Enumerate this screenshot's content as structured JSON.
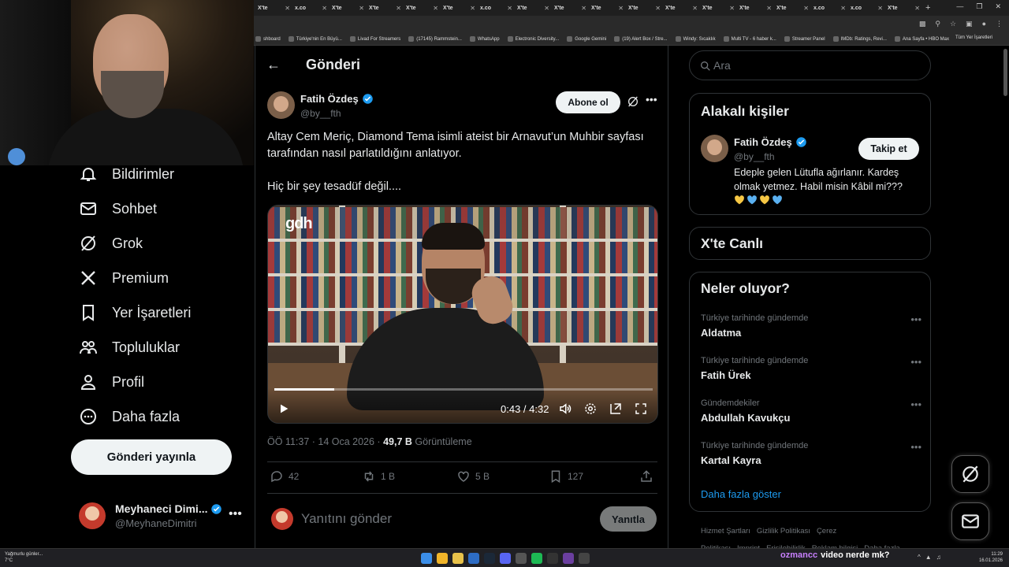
{
  "browser": {
    "tabs": [
      {
        "label": "X'te"
      },
      {
        "label": "x.co"
      },
      {
        "label": "X'te"
      },
      {
        "label": "X'te"
      },
      {
        "label": "X'te"
      },
      {
        "label": "X'te"
      },
      {
        "label": "x.co"
      },
      {
        "label": "X'te"
      },
      {
        "label": "X'te"
      },
      {
        "label": "X'te"
      },
      {
        "label": "X'te"
      },
      {
        "label": "X'te"
      },
      {
        "label": "X'te"
      },
      {
        "label": "X'te"
      },
      {
        "label": "X'te"
      },
      {
        "label": "x.co"
      },
      {
        "label": "x.co"
      },
      {
        "label": "X'te"
      }
    ],
    "bookmarks": [
      {
        "label": "shboard"
      },
      {
        "label": "Türkiye'nin En Büyü..."
      },
      {
        "label": "Livad For Streamers"
      },
      {
        "label": "(17145) Rammstein..."
      },
      {
        "label": "WhatsApp"
      },
      {
        "label": "Electronic Diversity..."
      },
      {
        "label": "Google Gemini"
      },
      {
        "label": "(19) Alert Box / Stre..."
      },
      {
        "label": "Windy: Sıcaklık"
      },
      {
        "label": "Multi TV - 6 haber k..."
      },
      {
        "label": "Streamer Panel"
      },
      {
        "label": "IMDb: Ratings, Revi..."
      },
      {
        "label": "Ana Sayfa • HBO Max"
      }
    ],
    "bookmarks_all": "Tüm Yer İşaretleri"
  },
  "nav": {
    "items": [
      {
        "label": "Bildirimler",
        "icon": "bell-icon"
      },
      {
        "label": "Sohbet",
        "icon": "mail-icon"
      },
      {
        "label": "Grok",
        "icon": "grok-icon"
      },
      {
        "label": "Premium",
        "icon": "x-logo-icon"
      },
      {
        "label": "Yer İşaretleri",
        "icon": "bookmark-icon"
      },
      {
        "label": "Topluluklar",
        "icon": "communities-icon"
      },
      {
        "label": "Profil",
        "icon": "person-icon"
      },
      {
        "label": "Daha fazla",
        "icon": "more-circle-icon"
      }
    ],
    "post_button": "Gönderi yayınla",
    "account": {
      "name": "Meyhaneci Dimi...",
      "handle": "@MeyhaneDimitri"
    }
  },
  "main": {
    "header_title": "Gönderi",
    "author": {
      "name": "Fatih Özdeş",
      "handle": "@by__fth",
      "subscribe_label": "Abone ol"
    },
    "text": {
      "line1": "Altay Cem Meriç, Diamond Tema isimli ateist bir Arnavut’un Muhbir sayfası tarafından nasıl parlatıldığını anlatıyor.",
      "line2": "Hiç bir şey tesadüf değil...."
    },
    "video": {
      "watermark": "gdh",
      "time": "0:43 / 4:32",
      "progress": 0.158
    },
    "meta": {
      "time": "ÖÖ 11:37 · 14 Oca 2026 · ",
      "views": "49,7 B",
      "views_label": " Görüntüleme"
    },
    "actions": {
      "replies": "42",
      "reposts": "1 B",
      "likes": "5 B",
      "bookmarks": "127"
    },
    "reply": {
      "placeholder": "Yanıtını gönder",
      "button": "Yanıtla"
    }
  },
  "right": {
    "search_placeholder": "Ara",
    "related": {
      "title": "Alakalı kişiler",
      "name": "Fatih Özdeş",
      "handle": "@by__fth",
      "follow": "Takip et",
      "bio": "Edeple gelen Lütufla ağırlanır. Kardeş olmak yetmez. Habil misin Kâbil mi???",
      "hearts": [
        "#f6c744",
        "#5ab0f0",
        "#f6c744",
        "#5ab0f0"
      ]
    },
    "live_title": "X'te Canlı",
    "trends": {
      "title": "Neler oluyor?",
      "items": [
        {
          "context": "Türkiye tarihinde gündemde",
          "topic": "Aldatma"
        },
        {
          "context": "Türkiye tarihinde gündemde",
          "topic": "Fatih Ürek"
        },
        {
          "context": "Gündemdekiler",
          "topic": "Abdullah Kavukçu"
        },
        {
          "context": "Türkiye tarihinde gündemde",
          "topic": "Kartal Kayra"
        }
      ],
      "show_more": "Daha fazla göster"
    },
    "footer": [
      "Hizmet Şartları",
      "Gizlilik Politikası",
      "Çerez Politikası",
      "Imprint",
      "Erişilebilirlik",
      "Reklam bilgisi",
      "Daha fazla ..."
    ]
  },
  "taskbar": {
    "weather_line1": "Yağmurlu günler...",
    "weather_line2": "7°C",
    "chat_user": "ozmancc",
    "chat_msg": "video nerde mk?",
    "clock_time": "11:29",
    "clock_date": "16.01.2026"
  },
  "colors": {
    "accent": "#1d9bf0",
    "verified": "#1d9bf0",
    "background": "#000000",
    "chat_user": "#c880ff"
  }
}
